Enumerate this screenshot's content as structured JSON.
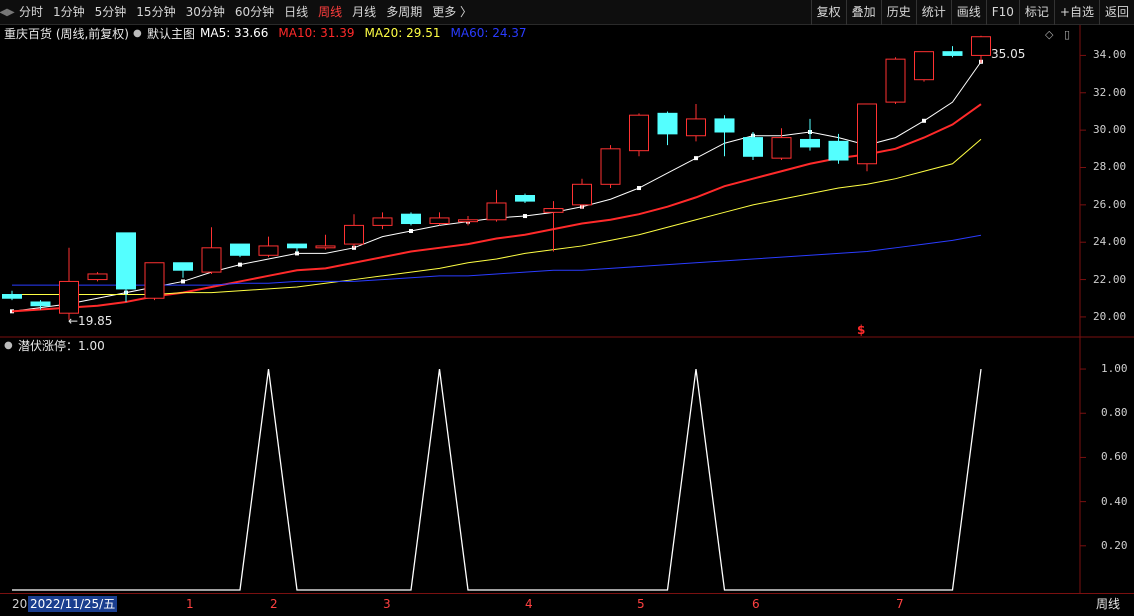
{
  "toolbar": {
    "left_items": [
      {
        "label": "分时",
        "active": false
      },
      {
        "label": "1分钟",
        "active": false
      },
      {
        "label": "5分钟",
        "active": false
      },
      {
        "label": "15分钟",
        "active": false
      },
      {
        "label": "30分钟",
        "active": false
      },
      {
        "label": "60分钟",
        "active": false
      },
      {
        "label": "日线",
        "active": false
      },
      {
        "label": "周线",
        "active": true
      },
      {
        "label": "月线",
        "active": false
      },
      {
        "label": "多周期",
        "active": false
      },
      {
        "label": "更多 〉",
        "active": false
      }
    ],
    "right_items": [
      "复权",
      "叠加",
      "历史",
      "统计",
      "画线",
      "F10",
      "标记",
      "+自选",
      "返回"
    ]
  },
  "main_panel": {
    "stock_title": "重庆百货 (周线,前复权)",
    "theme_label": "默认主图",
    "ma": [
      {
        "name": "MA5",
        "value": "33.66",
        "color": "#ffffff"
      },
      {
        "name": "MA10",
        "value": "31.39",
        "color": "#ff2a2a"
      },
      {
        "name": "MA20",
        "value": "29.51",
        "color": "#ffff44"
      },
      {
        "name": "MA60",
        "value": "24.37",
        "color": "#2a3cff"
      }
    ],
    "max_label": "35.05",
    "min_label": "←19.85",
    "signal_mark": "$",
    "y_ticks": [
      "34.00",
      "32.00",
      "30.00",
      "28.00",
      "26.00",
      "24.00",
      "22.00",
      "20.00"
    ]
  },
  "indicator_panel": {
    "title": "潜伏涨停：1.00",
    "y_ticks": [
      "1.00",
      "0.80",
      "0.60",
      "0.40",
      "0.20"
    ]
  },
  "bottom": {
    "date_left": "20",
    "cursor_date": "2022/11/25/五",
    "month_marks": [
      "1",
      "2",
      "3",
      "4",
      "5",
      "6",
      "7"
    ],
    "period_tab": "周线"
  },
  "chart_data": {
    "type": "candlestick",
    "ylim": [
      19.3,
      35.2
    ],
    "candles": [
      {
        "o": 21.2,
        "c": 21.0,
        "h": 21.4,
        "l": 20.9
      },
      {
        "o": 20.8,
        "c": 20.6,
        "h": 20.9,
        "l": 20.4
      },
      {
        "o": 20.2,
        "c": 21.9,
        "h": 23.7,
        "l": 19.85
      },
      {
        "o": 22.0,
        "c": 22.3,
        "h": 22.4,
        "l": 21.9
      },
      {
        "o": 24.5,
        "c": 21.5,
        "h": 24.5,
        "l": 20.8
      },
      {
        "o": 21.0,
        "c": 22.9,
        "h": 22.9,
        "l": 20.9
      },
      {
        "o": 22.9,
        "c": 22.5,
        "h": 22.9,
        "l": 22.1
      },
      {
        "o": 22.4,
        "c": 23.7,
        "h": 24.8,
        "l": 22.3
      },
      {
        "o": 23.9,
        "c": 23.3,
        "h": 23.9,
        "l": 23.2
      },
      {
        "o": 23.3,
        "c": 23.8,
        "h": 24.3,
        "l": 23.2
      },
      {
        "o": 23.9,
        "c": 23.7,
        "h": 23.9,
        "l": 23.5
      },
      {
        "o": 23.7,
        "c": 23.8,
        "h": 24.4,
        "l": 23.6
      },
      {
        "o": 23.9,
        "c": 24.9,
        "h": 25.5,
        "l": 23.7
      },
      {
        "o": 24.9,
        "c": 25.3,
        "h": 25.6,
        "l": 24.7
      },
      {
        "o": 25.5,
        "c": 25.0,
        "h": 25.6,
        "l": 24.9
      },
      {
        "o": 25.0,
        "c": 25.3,
        "h": 25.6,
        "l": 24.9
      },
      {
        "o": 25.1,
        "c": 25.2,
        "h": 25.4,
        "l": 24.9
      },
      {
        "o": 25.2,
        "c": 26.1,
        "h": 26.8,
        "l": 25.1
      },
      {
        "o": 26.5,
        "c": 26.2,
        "h": 26.6,
        "l": 26.1
      },
      {
        "o": 25.6,
        "c": 25.8,
        "h": 26.2,
        "l": 23.5
      },
      {
        "o": 26.0,
        "c": 27.1,
        "h": 27.4,
        "l": 25.8
      },
      {
        "o": 27.1,
        "c": 29.0,
        "h": 29.2,
        "l": 26.9
      },
      {
        "o": 28.9,
        "c": 30.8,
        "h": 30.9,
        "l": 28.6
      },
      {
        "o": 30.9,
        "c": 29.8,
        "h": 31.0,
        "l": 29.2
      },
      {
        "o": 29.7,
        "c": 30.6,
        "h": 31.4,
        "l": 29.4
      },
      {
        "o": 30.6,
        "c": 29.9,
        "h": 30.8,
        "l": 28.6
      },
      {
        "o": 29.6,
        "c": 28.6,
        "h": 29.9,
        "l": 28.4
      },
      {
        "o": 28.5,
        "c": 29.6,
        "h": 30.1,
        "l": 28.4
      },
      {
        "o": 29.5,
        "c": 29.1,
        "h": 30.6,
        "l": 28.9
      },
      {
        "o": 29.4,
        "c": 28.4,
        "h": 29.8,
        "l": 28.2
      },
      {
        "o": 28.2,
        "c": 31.4,
        "h": 31.4,
        "l": 27.8
      },
      {
        "o": 31.5,
        "c": 33.8,
        "h": 33.9,
        "l": 31.4
      },
      {
        "o": 32.7,
        "c": 34.2,
        "h": 34.2,
        "l": 32.6
      },
      {
        "o": 34.2,
        "c": 34.0,
        "h": 34.5,
        "l": 33.9
      },
      {
        "o": 34.0,
        "c": 35.0,
        "h": 35.05,
        "l": 33.6
      }
    ],
    "ma_series": [
      {
        "name": "MA5",
        "color": "#ffffff",
        "values": [
          20.3,
          20.5,
          20.7,
          21.0,
          21.3,
          21.6,
          21.9,
          22.4,
          22.8,
          23.1,
          23.4,
          23.4,
          23.7,
          24.3,
          24.6,
          24.9,
          25.1,
          25.3,
          25.4,
          25.6,
          25.9,
          26.3,
          26.9,
          27.7,
          28.5,
          29.3,
          29.7,
          29.7,
          29.9,
          29.6,
          29.2,
          29.6,
          30.5,
          31.5,
          33.66
        ]
      },
      {
        "name": "MA10",
        "color": "#ff2a2a",
        "values": [
          20.3,
          20.4,
          20.5,
          20.6,
          20.8,
          21.1,
          21.3,
          21.6,
          21.9,
          22.2,
          22.5,
          22.6,
          22.9,
          23.2,
          23.5,
          23.7,
          23.9,
          24.2,
          24.4,
          24.7,
          25.0,
          25.2,
          25.5,
          25.9,
          26.4,
          27.0,
          27.4,
          27.8,
          28.2,
          28.5,
          28.7,
          29.0,
          29.6,
          30.3,
          31.39
        ]
      },
      {
        "name": "MA20",
        "color": "#ffff44",
        "values": [
          21.2,
          21.2,
          21.2,
          21.2,
          21.2,
          21.2,
          21.3,
          21.3,
          21.4,
          21.5,
          21.6,
          21.8,
          22.0,
          22.2,
          22.4,
          22.6,
          22.9,
          23.1,
          23.4,
          23.6,
          23.8,
          24.1,
          24.4,
          24.8,
          25.2,
          25.6,
          26.0,
          26.3,
          26.6,
          26.9,
          27.1,
          27.4,
          27.8,
          28.2,
          29.51
        ]
      },
      {
        "name": "MA60",
        "color": "#2a3cff",
        "values": [
          21.7,
          21.7,
          21.7,
          21.7,
          21.7,
          21.7,
          21.7,
          21.7,
          21.8,
          21.8,
          21.9,
          21.9,
          21.9,
          22.0,
          22.1,
          22.2,
          22.2,
          22.3,
          22.4,
          22.5,
          22.5,
          22.6,
          22.7,
          22.8,
          22.9,
          23.0,
          23.1,
          23.2,
          23.3,
          23.4,
          23.5,
          23.7,
          23.9,
          24.1,
          24.37
        ]
      }
    ],
    "indicator": {
      "name": "潜伏涨停",
      "ylim": [
        0,
        1.05
      ],
      "values": [
        0,
        0,
        0,
        0,
        0,
        0,
        0,
        0,
        0,
        1,
        0,
        0,
        0,
        0,
        0,
        1,
        0,
        0,
        0,
        0,
        0,
        0,
        0,
        0,
        1,
        0,
        0,
        0,
        0,
        0,
        0,
        0,
        0,
        0,
        1
      ]
    }
  }
}
